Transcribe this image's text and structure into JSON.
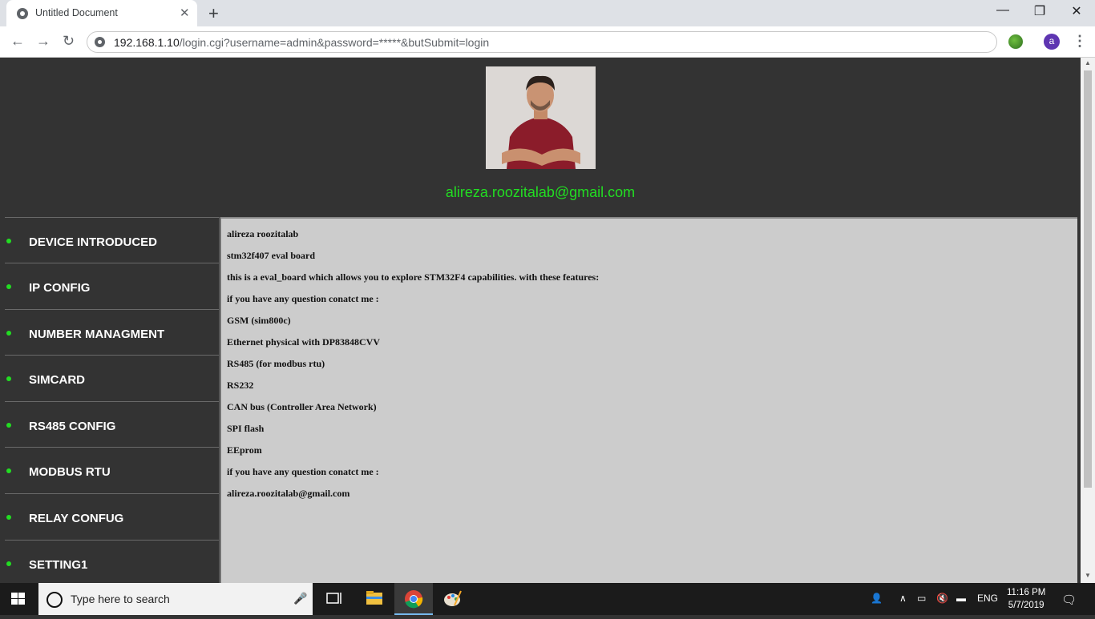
{
  "browser": {
    "tab_title": "Untitled Document",
    "tab_close": "✕",
    "new_tab": "+",
    "minimize": "—",
    "restore": "❐",
    "close": "✕",
    "back": "←",
    "forward": "→",
    "reload": "↻",
    "url_host": "192.168.1.10",
    "url_path": "/login.cgi?username=admin&password=*****&butSubmit=login",
    "profile_initial": "a",
    "menu": "⋮"
  },
  "page": {
    "header_email": "alireza.roozitalab@gmail.com",
    "sidebar": [
      {
        "label": "DEVICE INTRODUCED"
      },
      {
        "label": "IP CONFIG"
      },
      {
        "label": "NUMBER MANAGMENT"
      },
      {
        "label": "SIMCARD"
      },
      {
        "label": "RS485 CONFIG"
      },
      {
        "label": "MODBUS RTU"
      },
      {
        "label": "RELAY CONFUG"
      },
      {
        "label": "SETTING1"
      }
    ],
    "content": [
      "alireza roozitalab",
      "stm32f407 eval board",
      "this is a eval_board which allows you to explore STM32F4 capabilities. with these features:",
      "if you have any question conatct me :",
      "GSM (sim800c)",
      "Ethernet physical with DP83848CVV",
      "RS485 (for modbus rtu)",
      "RS232",
      "CAN bus (Controller Area Network)",
      "SPI flash",
      "EEprom",
      "if you have any question conatct me :",
      "alireza.roozitalab@gmail.com"
    ]
  },
  "taskbar": {
    "search_placeholder": "Type here to search",
    "language": "ENG",
    "time": "11:16 PM",
    "date": "5/7/2019"
  },
  "colors": {
    "accent_green": "#22dd22",
    "page_bg": "#333333",
    "content_bg": "#cccccc"
  }
}
